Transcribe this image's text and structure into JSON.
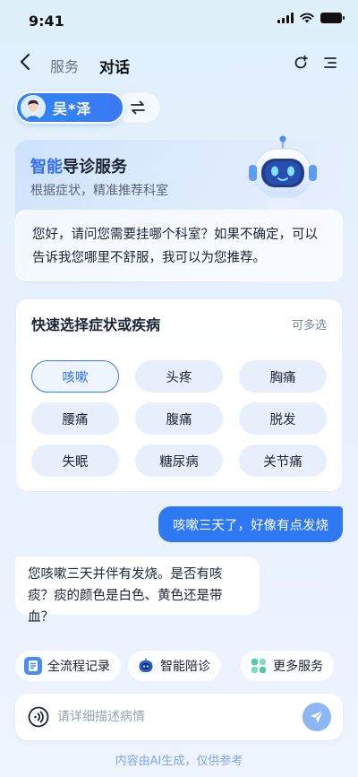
{
  "status": {
    "time": "9:41"
  },
  "nav": {
    "tab_service": "服务",
    "tab_chat": "对话"
  },
  "user": {
    "name": "吴*泽"
  },
  "hero": {
    "title_highlight": "智能",
    "title_rest": "导诊服务",
    "subtitle": "根据症状，精准推荐科室",
    "greeting": "您好，请问您需要挂哪个科室？如果不确定，可以告诉我您哪里不舒服，我可以为您推荐。"
  },
  "quick_select": {
    "title": "快速选择症状或疾病",
    "hint": "可多选",
    "chips": [
      {
        "label": "咳嗽",
        "selected": true
      },
      {
        "label": "头疼",
        "selected": false
      },
      {
        "label": "胸痛",
        "selected": false
      },
      {
        "label": "腰痛",
        "selected": false
      },
      {
        "label": "腹痛",
        "selected": false
      },
      {
        "label": "脱发",
        "selected": false
      },
      {
        "label": "失眠",
        "selected": false
      },
      {
        "label": "糖尿病",
        "selected": false
      },
      {
        "label": "关节痛",
        "selected": false
      }
    ]
  },
  "messages": {
    "user": "咳嗽三天了，好像有点发烧",
    "bot": "您咳嗽三天并伴有发烧。是否有咳痰？痰的颜色是白色、黄色还是带血？"
  },
  "actions": [
    {
      "label": "全流程记录",
      "icon": "record-icon"
    },
    {
      "label": "智能陪诊",
      "icon": "robot-icon"
    },
    {
      "label": "更多服务",
      "icon": "grid-icon"
    }
  ],
  "input": {
    "placeholder": "请详细描述病情"
  },
  "footer": {
    "disclaimer": "内容由AI生成，仅供参考"
  },
  "colors": {
    "accent": "#2f78f4",
    "chip_bg": "#e8effc",
    "disclaimer": "#7fa7e6"
  }
}
